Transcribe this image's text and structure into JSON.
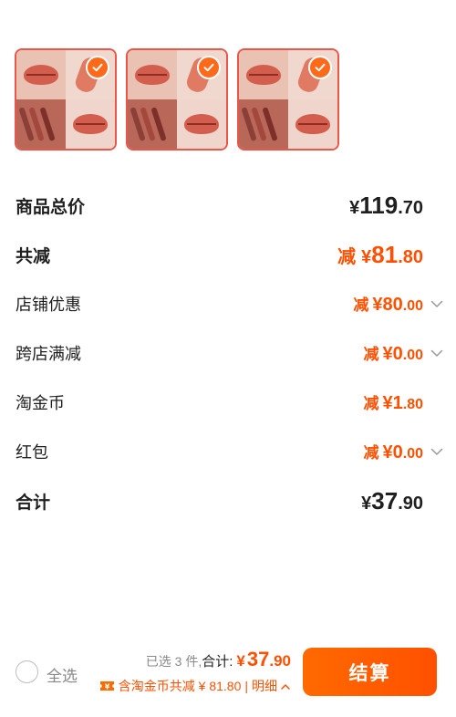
{
  "products": [
    {
      "selected": true
    },
    {
      "selected": true
    },
    {
      "selected": true
    }
  ],
  "breakdown": {
    "subtotal": {
      "label": "商品总价",
      "currency": "¥",
      "int": "119",
      "dec": ".70"
    },
    "total_discount": {
      "label": "共减",
      "prefix": "减",
      "currency": "¥",
      "int": "81",
      "dec": ".80"
    },
    "store_discount": {
      "label": "店铺优惠",
      "prefix": "减",
      "currency": "¥",
      "int": "80",
      "dec": ".00"
    },
    "cross_store": {
      "label": "跨店满减",
      "prefix": "减",
      "currency": "¥",
      "int": "0",
      "dec": ".00"
    },
    "coins": {
      "label": "淘金币",
      "prefix": "减",
      "currency": "¥",
      "int": "1",
      "dec": ".80"
    },
    "red_packet": {
      "label": "红包",
      "prefix": "减",
      "currency": "¥",
      "int": "0",
      "dec": ".00"
    },
    "total": {
      "label": "合计",
      "currency": "¥",
      "int": "37",
      "dec": ".90"
    }
  },
  "bottom_bar": {
    "select_all_label": "全选",
    "selected_count": "已选 3 件,",
    "total_label": "合计:",
    "total_currency": "¥",
    "total_int": " 37",
    "total_dec": ".90",
    "coin_text": "含淘金币共减 ¥ 81.80",
    "separator": "|",
    "detail_label": "明细",
    "checkout_label": "结算"
  },
  "colors": {
    "accent": "#ff5000",
    "thumb_border": "#e8584a",
    "text": "#1f1f1f",
    "muted": "#8a8a8a"
  }
}
